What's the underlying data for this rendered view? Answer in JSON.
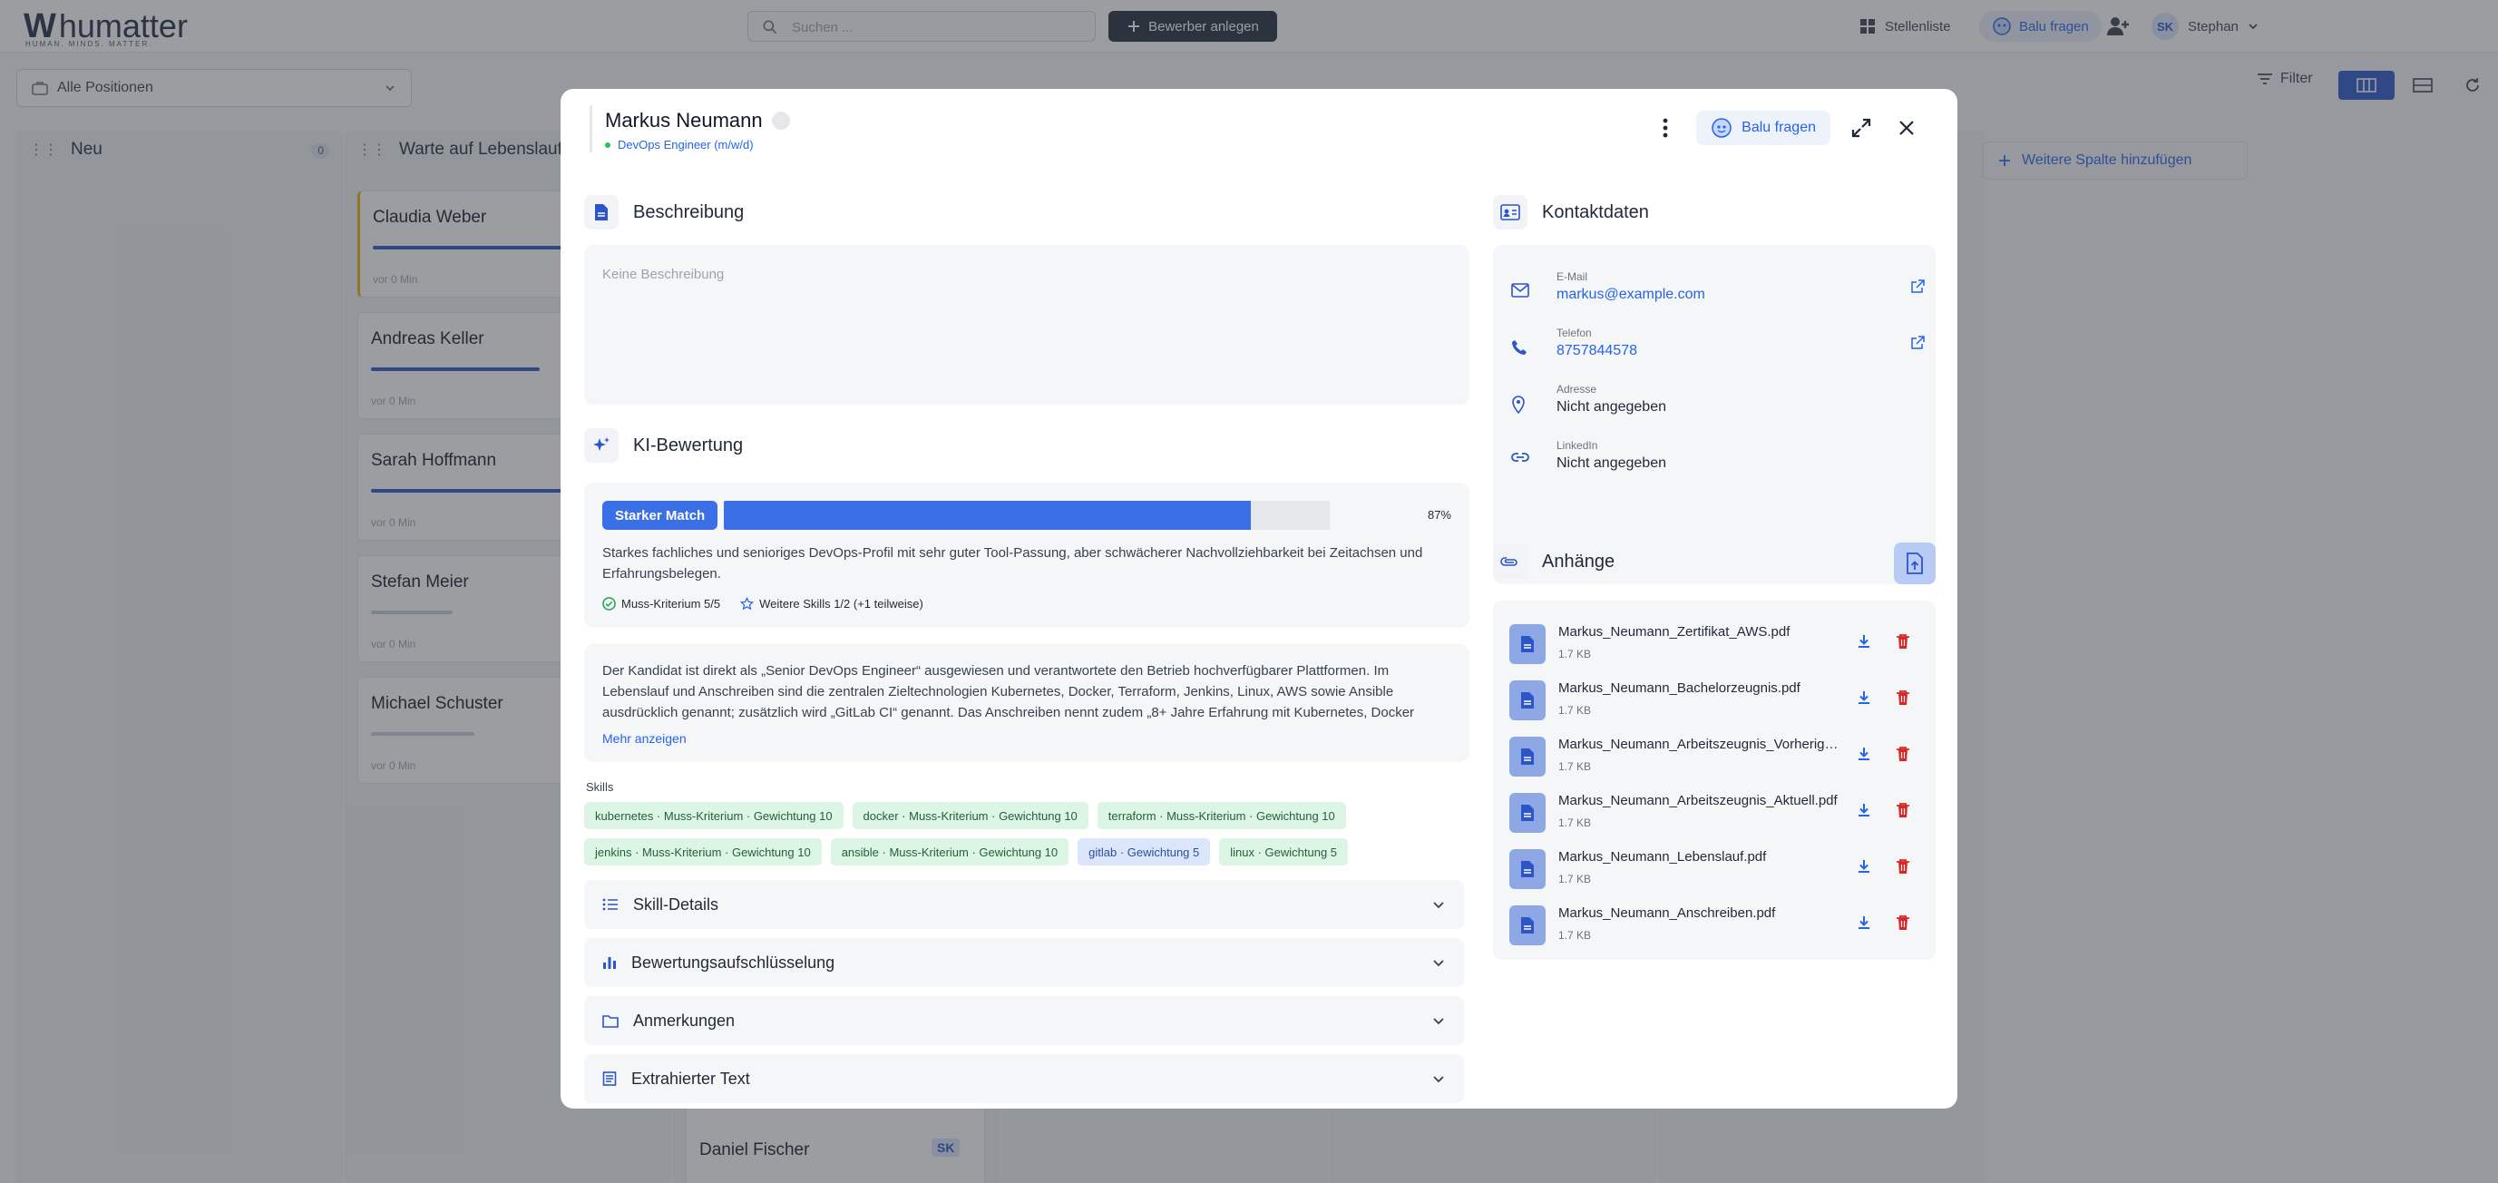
{
  "app": {
    "logo_mark": "W",
    "logo_text": "humatter",
    "logo_tagline": "HUMAN. MINDS. MATTER.",
    "search_placeholder": "Suchen ...",
    "new_applicant": "Bewerber anlegen",
    "job_list": "Stellenliste",
    "ask_balu": "Balu fragen",
    "user_initials": "SK",
    "user_name": "Stephan",
    "positions_filter": "Alle Positionen",
    "filter": "Filter",
    "add_column": "Weitere Spalte hinzufügen"
  },
  "board": {
    "columns": [
      {
        "title": "Neu",
        "count": "0"
      },
      {
        "title": "Warte auf Lebenslauf"
      }
    ],
    "cards": [
      {
        "name": "Claudia Weber",
        "time": "vor 0 Min",
        "progress": 0.85
      },
      {
        "name": "Andreas Keller",
        "time": "vor 0 Min",
        "progress": 0.62
      },
      {
        "name": "Sarah Hoffmann",
        "time": "vor 0 Min",
        "progress": 0.9
      },
      {
        "name": "Stefan Meier",
        "time": "vor 0 Min",
        "progress": 0.3
      },
      {
        "name": "Michael Schuster",
        "time": "vor 0 Min",
        "progress": 0.38
      }
    ],
    "hidden_card": {
      "name": "Daniel Fischer",
      "initials": "SK"
    }
  },
  "modal": {
    "name": "Markus Neumann",
    "position": "DevOps Engineer (m/w/d)",
    "ask_balu": "Balu fragen",
    "description": {
      "title": "Beschreibung",
      "placeholder": "Keine Beschreibung"
    },
    "ai": {
      "title": "KI-Bewertung",
      "badge": "Starker Match",
      "score": 0.87,
      "score_label": "87%",
      "summary": "Starkes fachliches und senioriges DevOps-Profil mit sehr guter Tool-Passung, aber schwächerer Nachvollziehbarkeit bei Zeitachsen und Erfahrungsbelegen.",
      "must_criteria": "Muss-Kriterium 5/5",
      "further_skills": "Weitere Skills 1/2 (+1 teilweise)",
      "details": "Der Kandidat ist direkt als „Senior DevOps Engineer“ ausgewiesen und verantwortete den Betrieb hochverfügbarer Plattformen. Im Lebenslauf und Anschreiben sind die zentralen Zieltechnologien Kubernetes, Docker, Terraform, Jenkins, Linux, AWS sowie Ansible ausdrücklich genannt; zusätzlich wird „GitLab CI“ genannt. Das Anschreiben nennt zudem „8+ Jahre Erfahrung mit Kubernetes, Docker",
      "show_more": "Mehr anzeigen"
    },
    "skills_label": "Skills",
    "skills": [
      {
        "label": "kubernetes · Muss-Kriterium · Gewichtung 10",
        "type": "green"
      },
      {
        "label": "docker · Muss-Kriterium · Gewichtung 10",
        "type": "green"
      },
      {
        "label": "terraform · Muss-Kriterium · Gewichtung 10",
        "type": "green"
      },
      {
        "label": "jenkins · Muss-Kriterium · Gewichtung 10",
        "type": "green"
      },
      {
        "label": "ansible · Muss-Kriterium · Gewichtung 10",
        "type": "green"
      },
      {
        "label": "gitlab · Gewichtung 5",
        "type": "blue"
      },
      {
        "label": "linux · Gewichtung 5",
        "type": "green"
      }
    ],
    "accordions": [
      {
        "label": "Skill-Details",
        "icon": "list-icon"
      },
      {
        "label": "Bewertungsaufschlüsselung",
        "icon": "bar-chart-icon"
      },
      {
        "label": "Anmerkungen",
        "icon": "folder-icon"
      },
      {
        "label": "Extrahierter Text",
        "icon": "document-icon"
      }
    ],
    "contact": {
      "title": "Kontaktdaten",
      "email_label": "E-Mail",
      "email": "markus@example.com",
      "phone_label": "Telefon",
      "phone": "8757844578",
      "address_label": "Adresse",
      "address": "Nicht angegeben",
      "linkedin_label": "LinkedIn",
      "linkedin": "Nicht angegeben"
    },
    "attachments": {
      "title": "Anhänge",
      "files": [
        {
          "name": "Markus_Neumann_Zertifikat_AWS.pdf",
          "size": "1.7 KB"
        },
        {
          "name": "Markus_Neumann_Bachelorzeugnis.pdf",
          "size": "1.7 KB"
        },
        {
          "name": "Markus_Neumann_Arbeitszeugnis_Vorherige.pdf",
          "size": "1.7 KB"
        },
        {
          "name": "Markus_Neumann_Arbeitszeugnis_Aktuell.pdf",
          "size": "1.7 KB"
        },
        {
          "name": "Markus_Neumann_Lebenslauf.pdf",
          "size": "1.7 KB"
        },
        {
          "name": "Markus_Neumann_Anschreiben.pdf",
          "size": "1.7 KB"
        }
      ]
    }
  },
  "colors": {
    "accent": "#3b6fe8",
    "danger": "#dc2626",
    "chip_green": "#dcf5e4",
    "chip_blue": "#dbe6fb"
  }
}
